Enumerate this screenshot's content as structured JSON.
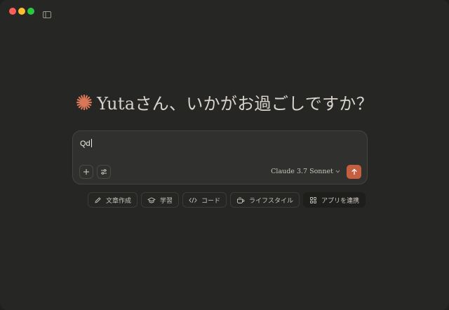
{
  "window": {
    "traffic_lights": [
      "close",
      "minimize",
      "zoom"
    ],
    "sidebar_toggle_icon": "sidebar-icon"
  },
  "greeting": {
    "icon": "claude-spark-icon",
    "icon_color": "#d97757",
    "text": "Yutaさん、いかがお過ごしですか？"
  },
  "composer": {
    "input_value": "Qd",
    "add_icon": "plus-icon",
    "settings_icon": "sliders-icon",
    "model_label": "Claude 3.7 Sonnet",
    "model_icon": "chevron-down-icon",
    "send_icon": "arrow-up-icon",
    "send_color": "#c4603f"
  },
  "suggestions": [
    {
      "label": "文章作成",
      "icon": "pencil-icon"
    },
    {
      "label": "学習",
      "icon": "graduation-cap-icon"
    },
    {
      "label": "コード",
      "icon": "code-icon"
    },
    {
      "label": "ライフスタイル",
      "icon": "coffee-cup-icon"
    },
    {
      "label": "アプリを連携",
      "icon": "grid-icon"
    }
  ]
}
